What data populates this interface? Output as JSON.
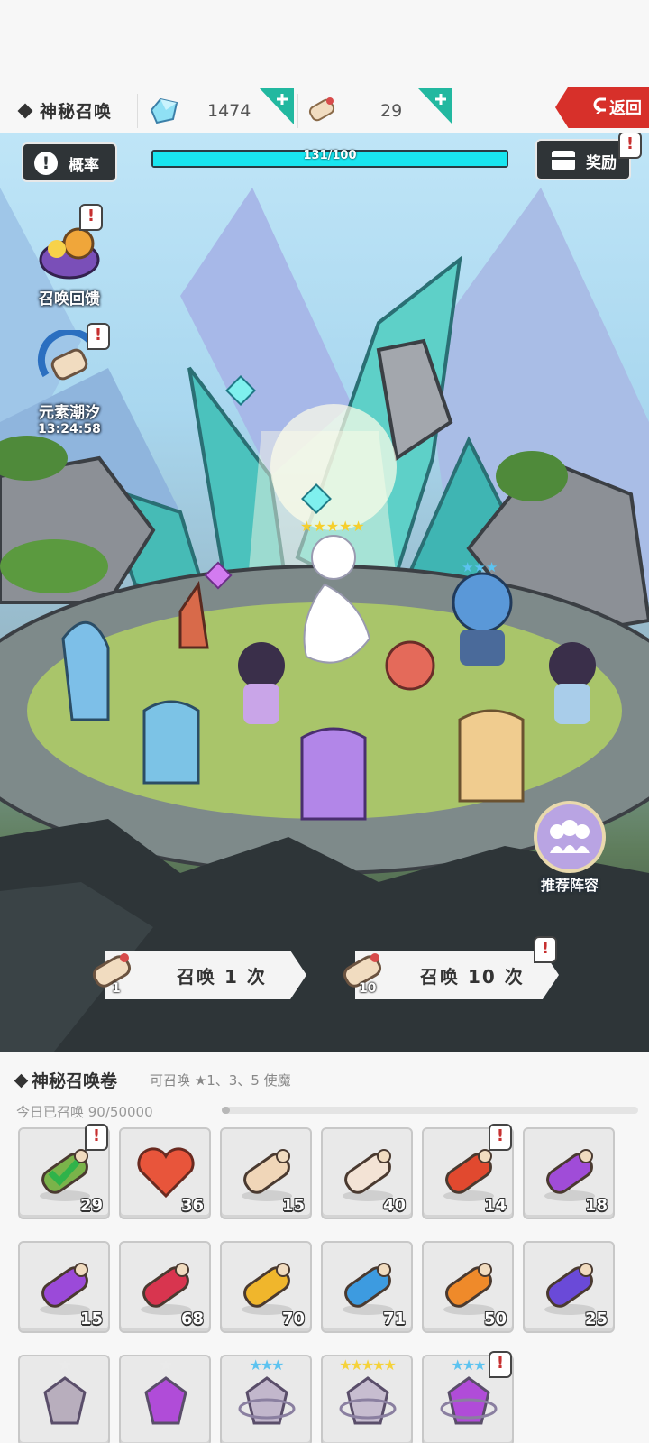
{
  "header": {
    "title": "神秘召唤",
    "back_label": "返回",
    "resources": [
      {
        "icon": "crystal-icon",
        "value": "1474"
      },
      {
        "icon": "scroll-icon",
        "value": "29"
      }
    ]
  },
  "scene": {
    "probability_label": "概率",
    "progress_text": "131/100",
    "progress_fraction": 1.0,
    "reward_label": "奖励",
    "side_buttons": [
      {
        "label": "召唤回馈"
      },
      {
        "label": "元素潮汐",
        "timer": "13:24:58"
      }
    ],
    "recommend_label": "推荐阵容",
    "summon_buttons": [
      {
        "label": "召唤 1 次",
        "cost": "1"
      },
      {
        "label": "召唤 10 次",
        "cost": "10"
      }
    ]
  },
  "panel": {
    "title": "神秘召唤卷",
    "subtitle": "可召唤 ★1、3、5 使魔",
    "today_text": "今日已召唤 90/50000",
    "today_fraction": 0.0018,
    "items": [
      {
        "name": "check-scroll",
        "count": "29",
        "color": "#7ab34a",
        "alert": true
      },
      {
        "name": "heart",
        "count": "36",
        "color": "#e8553b",
        "alert": false
      },
      {
        "name": "white-scroll-ribbon",
        "count": "15",
        "color": "#f0d6b8",
        "alert": false
      },
      {
        "name": "white-scroll-pink",
        "count": "40",
        "color": "#f3e3d5",
        "alert": false
      },
      {
        "name": "fire-scroll",
        "count": "14",
        "color": "#e1492f",
        "alert": true
      },
      {
        "name": "purple-scroll",
        "count": "18",
        "color": "#a04cd8",
        "alert": false
      },
      {
        "name": "violet-scroll",
        "count": "15",
        "color": "#9b4ad9",
        "alert": false
      },
      {
        "name": "red-scroll",
        "count": "68",
        "color": "#d8354f",
        "alert": false
      },
      {
        "name": "gold-scroll",
        "count": "70",
        "color": "#f0b62c",
        "alert": false
      },
      {
        "name": "blue-scroll",
        "count": "71",
        "color": "#3d9be0",
        "alert": false
      },
      {
        "name": "orange-scroll",
        "count": "50",
        "color": "#ef8a2a",
        "alert": false
      },
      {
        "name": "indigo-scroll",
        "count": "25",
        "color": "#6a4ad8",
        "alert": false
      },
      {
        "name": "grey-shard",
        "count": "",
        "color": "#b8aebd",
        "stars": "★",
        "star_color": "#eaeaea",
        "alert": false
      },
      {
        "name": "purple-shard",
        "count": "",
        "color": "#b04cd8",
        "stars": "★",
        "star_color": "#eaeaea",
        "alert": false
      },
      {
        "name": "ring-shard-3",
        "count": "",
        "color": "#c2b7cc",
        "stars": "★★★",
        "star_color": "#5cc3f0",
        "alert": false
      },
      {
        "name": "ring-shard-5",
        "count": "",
        "color": "#c7bdd0",
        "stars": "★★★★★",
        "star_color": "#f5d23a",
        "alert": false
      },
      {
        "name": "ring-shard-purple",
        "count": "",
        "color": "#b04cd8",
        "stars": "★★★",
        "star_color": "#5cc3f0",
        "alert": true
      }
    ]
  },
  "alert_mark": "!"
}
